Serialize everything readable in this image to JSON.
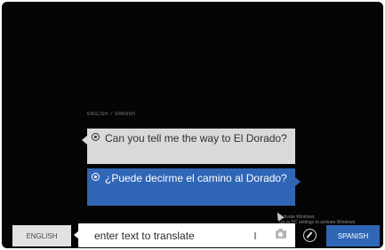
{
  "translator": {
    "language_pair": "ENGLISH ✓ SPANISH",
    "source_bubble": {
      "text": "Can you tell me the way to El Dorado?",
      "icon": "speaker-icon"
    },
    "target_bubble": {
      "text": "¿Puede decirme el camino al Dorado?",
      "icon": "speaker-icon"
    }
  },
  "watermark": {
    "line1": "Activate Windows",
    "line2": "Go to PC settings to activate Windows."
  },
  "input": {
    "text": "enter text to translate",
    "icons": [
      "microphone-icon",
      "camera-icon"
    ]
  },
  "bottom_bar": {
    "source_language": "ENGLISH",
    "target_language": "SPANISH",
    "compass_icon": "compass-icon"
  },
  "colors": {
    "background": "#050505",
    "accent_blue": "#2f66b6",
    "source_bubble": "#d9d9d9"
  }
}
